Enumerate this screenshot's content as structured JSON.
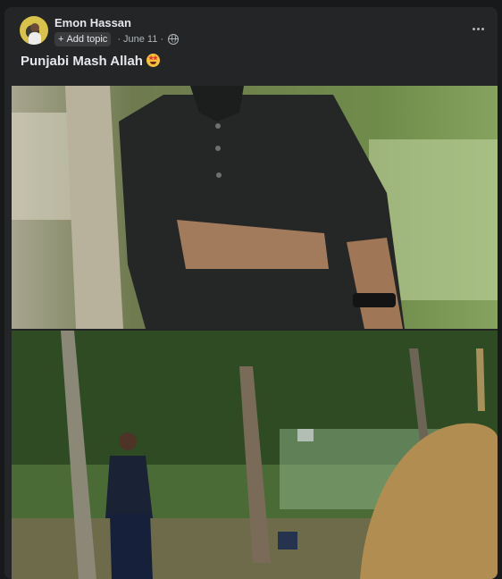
{
  "post": {
    "author": "Emon Hassan",
    "add_topic_label": "Add topic",
    "date": "June 11",
    "separator": "·",
    "privacy_icon": "globe-icon",
    "more_icon": "more-horizontal-icon",
    "caption": "Punjabi Mash Allah",
    "caption_emoji": "star-struck-emoji"
  },
  "photos": [
    {
      "description_icon": "photo-closeup"
    },
    {
      "description_icon": "photo-garden"
    }
  ],
  "colors": {
    "background": "#18191a",
    "card": "#242526",
    "text_primary": "#e4e6eb",
    "text_secondary": "#b0b3b8"
  }
}
